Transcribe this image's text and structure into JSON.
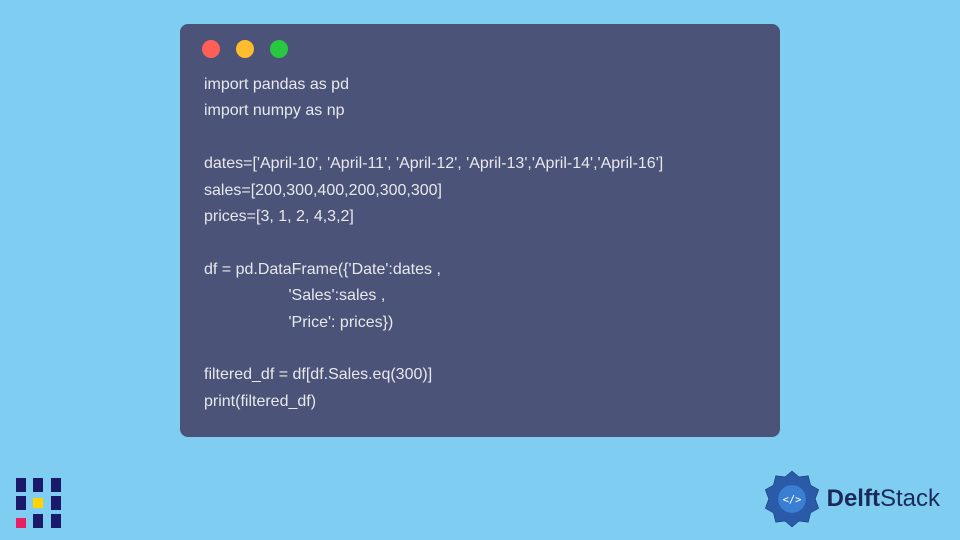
{
  "code_lines": [
    "import pandas as pd",
    "import numpy as np",
    "",
    "dates=['April-10', 'April-11', 'April-12', 'April-13','April-14','April-16']",
    "sales=[200,300,400,200,300,300]",
    "prices=[3, 1, 2, 4,3,2]",
    "",
    "df = pd.DataFrame({'Date':dates ,",
    "                   'Sales':sales ,",
    "                   'Price': prices})",
    "",
    "filtered_df = df[df.Sales.eq(300)]",
    "print(filtered_df)"
  ],
  "brand": {
    "prefix": "Delft",
    "suffix": "Stack"
  },
  "colors": {
    "background": "#80cdf2",
    "window": "#4b5378",
    "text": "#e8e8ec",
    "brand": "#1a2a5a"
  }
}
